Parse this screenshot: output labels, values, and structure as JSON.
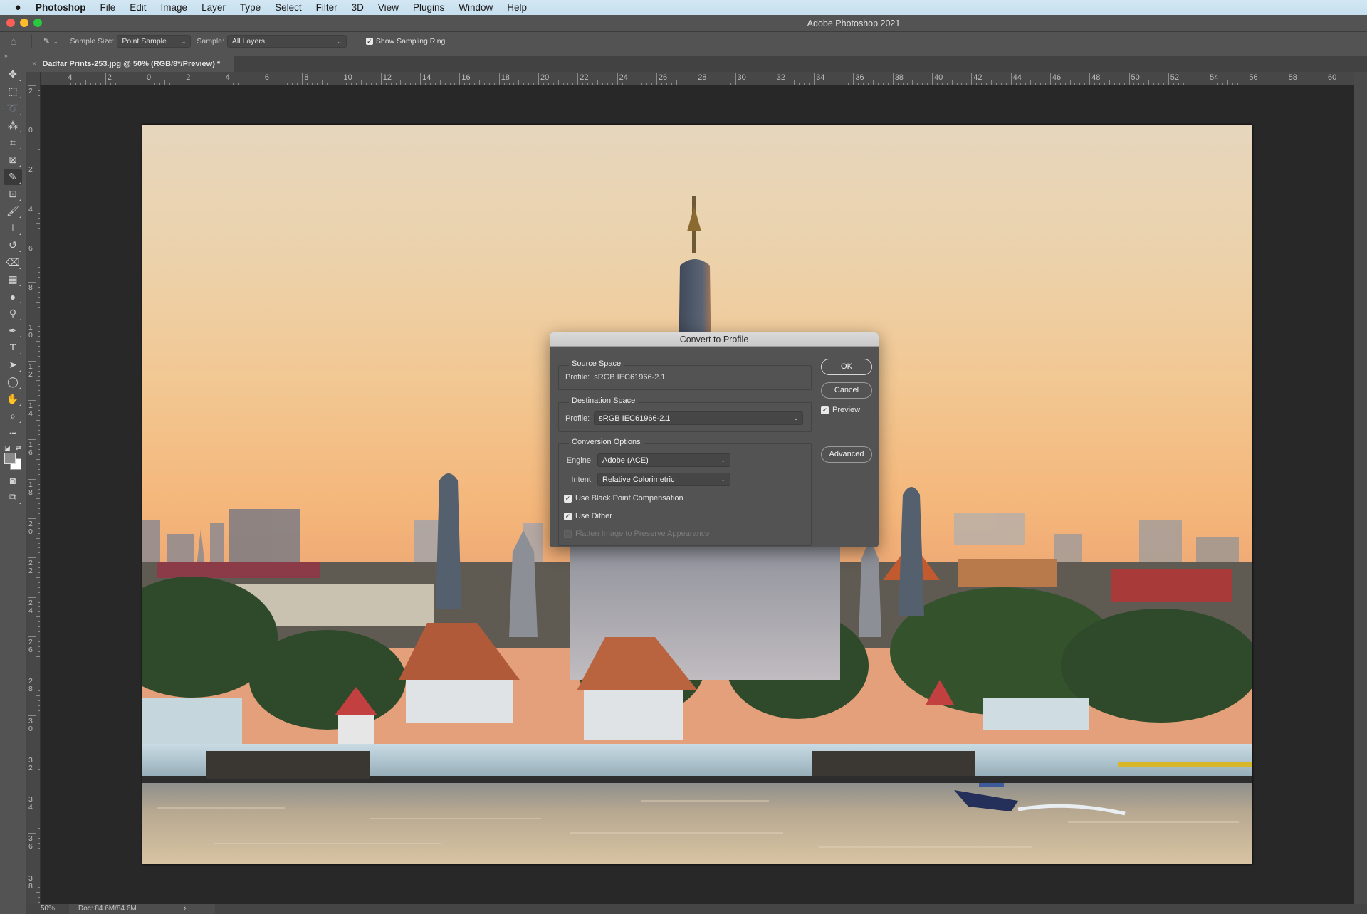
{
  "menubar": {
    "app_name": "Photoshop",
    "items": [
      "File",
      "Edit",
      "Image",
      "Layer",
      "Type",
      "Select",
      "Filter",
      "3D",
      "View",
      "Plugins",
      "Window",
      "Help"
    ]
  },
  "window": {
    "title": "Adobe Photoshop 2021",
    "traffic_lights": {
      "close": "#fc5f57",
      "minimize": "#fdbc2e",
      "zoom": "#29c840"
    }
  },
  "options_bar": {
    "home_icon": "home-icon",
    "tool_icon": "eyedropper-icon",
    "sample_size_label": "Sample Size:",
    "sample_size_value": "Point Sample",
    "sample_label": "Sample:",
    "sample_value": "All Layers",
    "show_sampling_ring_label": "Show Sampling Ring",
    "show_sampling_ring_checked": true
  },
  "document_tab": {
    "title": "Dadfar Prints-253.jpg @ 50% (RGB/8*/Preview) *",
    "close_glyph": "×"
  },
  "toolbar": {
    "collapse_glyph": "»",
    "tools": [
      {
        "name": "move-tool",
        "glyph": "✥",
        "active": false
      },
      {
        "name": "rectangular-marquee-tool",
        "glyph": "⬚",
        "active": false
      },
      {
        "name": "lasso-tool",
        "glyph": "➰",
        "active": false
      },
      {
        "name": "magic-wand-tool",
        "glyph": "⁂",
        "active": false
      },
      {
        "name": "crop-tool",
        "glyph": "⌗",
        "active": false
      },
      {
        "name": "frame-tool",
        "glyph": "⊠",
        "active": false
      },
      {
        "name": "eyedropper-tool",
        "glyph": "✎",
        "active": true
      },
      {
        "name": "spot-healing-tool",
        "glyph": "⊡",
        "active": false
      },
      {
        "name": "brush-tool",
        "glyph": "🖌",
        "active": false
      },
      {
        "name": "clone-stamp-tool",
        "glyph": "⊥",
        "active": false
      },
      {
        "name": "history-brush-tool",
        "glyph": "↺",
        "active": false
      },
      {
        "name": "eraser-tool",
        "glyph": "⌫",
        "active": false
      },
      {
        "name": "gradient-tool",
        "glyph": "▦",
        "active": false
      },
      {
        "name": "blur-tool",
        "glyph": "●",
        "active": false
      },
      {
        "name": "dodge-tool",
        "glyph": "⚲",
        "active": false
      },
      {
        "name": "pen-tool",
        "glyph": "✒",
        "active": false
      },
      {
        "name": "type-tool",
        "glyph": "T",
        "active": false
      },
      {
        "name": "path-selection-tool",
        "glyph": "➤",
        "active": false
      },
      {
        "name": "ellipse-tool",
        "glyph": "◯",
        "active": false
      },
      {
        "name": "hand-tool",
        "glyph": "✋",
        "active": false
      },
      {
        "name": "zoom-tool",
        "glyph": "⌕",
        "active": false
      },
      {
        "name": "edit-toolbar",
        "glyph": "•••",
        "active": false
      }
    ],
    "foreground_color": "#8a8a8a",
    "background_color": "#ffffff",
    "quick_mask_glyph": "◙",
    "screen_mode_glyph": "⧉"
  },
  "rulers": {
    "horizontal_labels": [
      "4",
      "2",
      "0",
      "2",
      "4",
      "6",
      "8",
      "10",
      "12",
      "14",
      "16",
      "18",
      "20",
      "22",
      "24",
      "26",
      "28",
      "30",
      "32",
      "34",
      "36",
      "38",
      "40",
      "42",
      "44",
      "46",
      "48",
      "50",
      "52",
      "54",
      "56",
      "58",
      "60"
    ],
    "vertical_labels": [
      "2",
      "0",
      "2",
      "4",
      "6",
      "8",
      "10",
      "12",
      "14",
      "16",
      "18",
      "20",
      "22",
      "24",
      "26",
      "28",
      "30",
      "32",
      "34",
      "36",
      "38"
    ]
  },
  "status_bar": {
    "zoom": "50%",
    "doc_info": "Doc: 84.6M/84.6M",
    "arrow": "›"
  },
  "photo": {
    "description": "Wat Arun temple at sunset over the Chao Phraya river with a speedboat"
  },
  "dialog": {
    "title": "Convert to Profile",
    "source_space": {
      "label": "Source Space",
      "profile_label": "Profile:",
      "profile_value": "sRGB IEC61966-2.1"
    },
    "destination_space": {
      "label": "Destination Space",
      "profile_label": "Profile:",
      "profile_value": "sRGB IEC61966-2.1"
    },
    "conversion_options": {
      "label": "Conversion Options",
      "engine_label": "Engine:",
      "engine_value": "Adobe (ACE)",
      "intent_label": "Intent:",
      "intent_value": "Relative Colorimetric",
      "black_point_label": "Use Black Point Compensation",
      "black_point_checked": true,
      "dither_label": "Use Dither",
      "dither_checked": true,
      "flatten_label": "Flatten Image to Preserve Appearance",
      "flatten_checked": false,
      "flatten_enabled": false
    },
    "buttons": {
      "ok": "OK",
      "cancel": "Cancel",
      "advanced": "Advanced"
    },
    "preview_label": "Preview",
    "preview_checked": true
  }
}
